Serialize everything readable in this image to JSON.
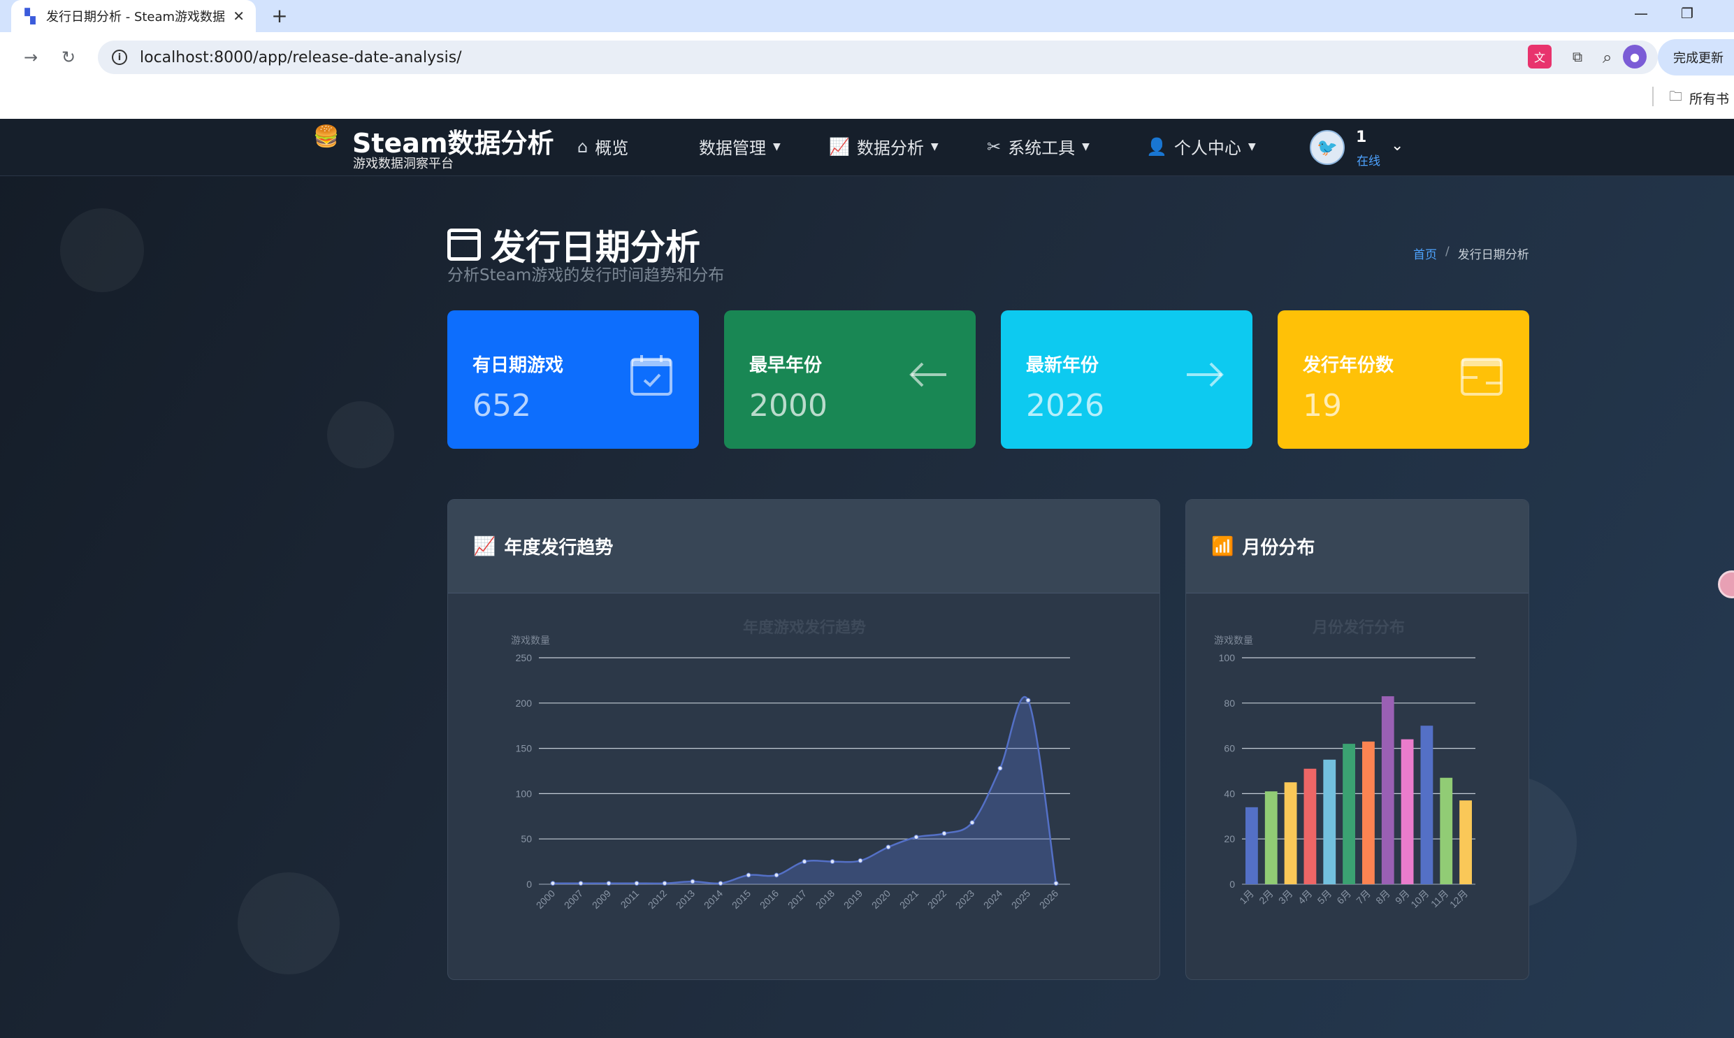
{
  "browser": {
    "tab_title": "发行日期分析 - Steam游戏数据",
    "url": "localhost:8000/app/release-date-analysis/",
    "update_label": "完成更新",
    "bookmarks_label": "所有书"
  },
  "nav": {
    "brand_title": "Steam数据分析",
    "brand_subtitle": "游戏数据洞察平台",
    "items": [
      {
        "label": "概览",
        "icon": "home-icon"
      },
      {
        "label": "数据管理",
        "icon": ""
      },
      {
        "label": "数据分析",
        "icon": "chart-line-icon"
      },
      {
        "label": "系统工具",
        "icon": "tools-icon"
      },
      {
        "label": "个人中心",
        "icon": "user-icon"
      }
    ],
    "user_name": "1",
    "user_status": "在线"
  },
  "page": {
    "title": "发行日期分析",
    "subtitle": "分析Steam游戏的发行时间趋势和分布",
    "breadcrumb_home": "首页",
    "breadcrumb_sep": "/",
    "breadcrumb_current": "发行日期分析"
  },
  "stats": [
    {
      "label": "有日期游戏",
      "value": "652",
      "color": "#0d6efd",
      "icon": "calendar-check-icon"
    },
    {
      "label": "最早年份",
      "value": "2000",
      "color": "#198754",
      "icon": "arrow-left-icon"
    },
    {
      "label": "最新年份",
      "value": "2026",
      "color": "#0dcaf0",
      "icon": "arrow-right-icon"
    },
    {
      "label": "发行年份数",
      "value": "19",
      "color": "#ffc107",
      "icon": "calendar-range-icon"
    }
  ],
  "panels": {
    "yearly_title": "年度发行趋势",
    "monthly_title": "月份分布"
  },
  "chart_data": [
    {
      "type": "area",
      "title": "年度游戏发行趋势",
      "ylabel": "游戏数量",
      "xlabel": "",
      "ylim": [
        0,
        250
      ],
      "yticks": [
        0,
        50,
        100,
        150,
        200,
        250
      ],
      "categories": [
        "2000",
        "2007",
        "2009",
        "2011",
        "2012",
        "2013",
        "2014",
        "2015",
        "2016",
        "2017",
        "2018",
        "2019",
        "2020",
        "2021",
        "2022",
        "2023",
        "2024",
        "2025",
        "2026"
      ],
      "values": [
        1,
        1,
        1,
        1,
        1,
        3,
        1,
        10,
        10,
        25,
        25,
        26,
        41,
        52,
        56,
        68,
        128,
        203,
        1
      ],
      "color": "#5470c6"
    },
    {
      "type": "bar",
      "title": "月份发行分布",
      "ylabel": "游戏数量",
      "xlabel": "",
      "ylim": [
        0,
        100
      ],
      "yticks": [
        0,
        20,
        40,
        60,
        80,
        100
      ],
      "categories": [
        "1月",
        "2月",
        "3月",
        "4月",
        "5月",
        "6月",
        "7月",
        "8月",
        "9月",
        "10月",
        "11月",
        "12月"
      ],
      "values": [
        34,
        41,
        45,
        51,
        55,
        62,
        63,
        83,
        64,
        70,
        47,
        37
      ],
      "colors": [
        "#5470c6",
        "#91cc75",
        "#fac858",
        "#ee6666",
        "#73c0de",
        "#3ba272",
        "#fc8452",
        "#9a60b4",
        "#ea7ccc",
        "#5470c6",
        "#91cc75",
        "#fac858"
      ]
    }
  ]
}
